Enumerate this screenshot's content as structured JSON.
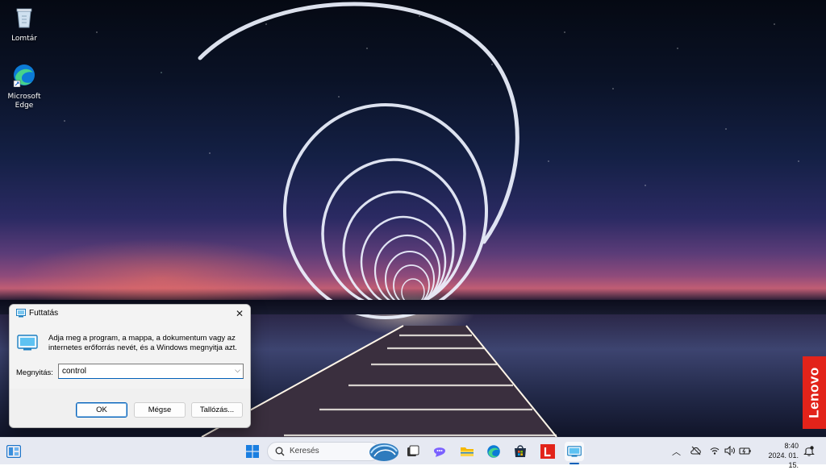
{
  "desktop": {
    "icons": [
      {
        "label": "Lomtár",
        "icon": "recycle-bin-icon"
      },
      {
        "label": "Microsoft Edge",
        "icon": "edge-icon"
      }
    ],
    "brand_badge": "Lenovo",
    "brand_color": "#e2231a"
  },
  "run_dialog": {
    "title": "Futtatás",
    "description": "Adja meg a program, a mappa, a dokumentum vagy az internetes erőforrás nevét, és a Windows megnyitja azt.",
    "open_label": "Megnyitás:",
    "open_value": "control",
    "buttons": {
      "ok": "OK",
      "cancel": "Mégse",
      "browse": "Tallózás..."
    },
    "close_icon": "close-icon",
    "accent": "#005fb8"
  },
  "taskbar": {
    "search_placeholder": "Keresés",
    "pinned": [
      "widgets-icon",
      "start-icon",
      "task-view-icon",
      "teams-chat-icon",
      "file-explorer-icon",
      "edge-icon",
      "store-icon",
      "lenovo-app-icon",
      "run-icon"
    ],
    "tray": [
      "chevron-up-icon",
      "onedrive-icon",
      "wifi-icon",
      "volume-icon",
      "battery-icon",
      "notification-icon"
    ],
    "time": "8:40",
    "date": "2024. 01. 15."
  }
}
